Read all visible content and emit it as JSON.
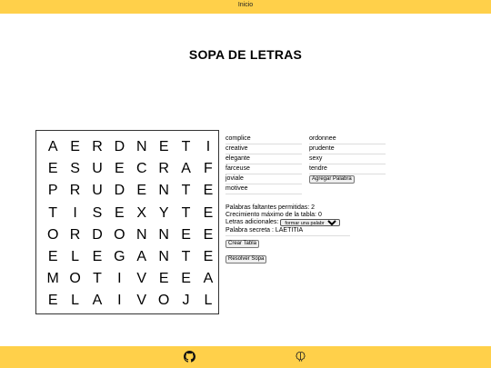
{
  "nav": {
    "home_label": "Inicio"
  },
  "page": {
    "title": "SOPA DE LETRAS"
  },
  "grid": {
    "rows": [
      [
        "A",
        "E",
        "R",
        "D",
        "N",
        "E",
        "T",
        "I"
      ],
      [
        "E",
        "S",
        "U",
        "E",
        "C",
        "R",
        "A",
        "F"
      ],
      [
        "P",
        "R",
        "U",
        "D",
        "E",
        "N",
        "T",
        "E"
      ],
      [
        "T",
        "I",
        "S",
        "E",
        "X",
        "Y",
        "T",
        "E"
      ],
      [
        "O",
        "R",
        "D",
        "O",
        "N",
        "N",
        "E",
        "E"
      ],
      [
        "E",
        "L",
        "E",
        "G",
        "A",
        "N",
        "T",
        "E"
      ],
      [
        "M",
        "O",
        "T",
        "I",
        "V",
        "E",
        "E",
        "A"
      ],
      [
        "E",
        "L",
        "A",
        "I",
        "V",
        "O",
        "J",
        "L"
      ]
    ]
  },
  "words": {
    "list": [
      "complice",
      "ordonnee",
      "creative",
      "prudente",
      "elegante",
      "sexy",
      "farceuse",
      "tendre",
      "joviale",
      "motivee"
    ],
    "add_button": "Agregar Palabra"
  },
  "info": {
    "faltantes_label": "Palabras faltantes permitidas:",
    "faltantes_value": "2",
    "crecimiento_label": "Crecimiento máximo de la tabla:",
    "crecimiento_value": "0",
    "letras_label": "Letras adicionales:",
    "letras_selected": "formar una palabra sec",
    "secreta_label": "Palabra secreta :",
    "secreta_value": "LAETITIA"
  },
  "buttons": {
    "create": "Crear Tabla",
    "solve": "Resolver Sopa"
  },
  "footer": {
    "icons": [
      "github-icon",
      "brain-icon"
    ]
  },
  "colors": {
    "accent": "#ffd04a"
  }
}
